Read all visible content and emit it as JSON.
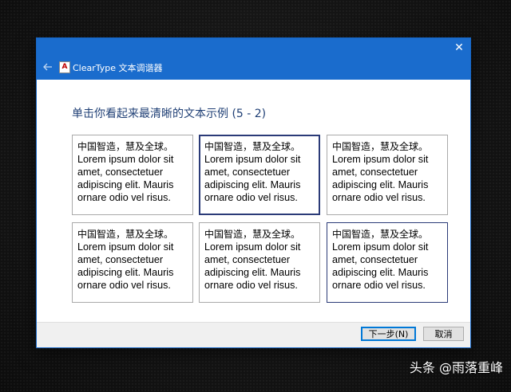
{
  "window": {
    "title": "ClearType 文本调谐器",
    "close_symbol": "✕",
    "app_icon_letter": "A"
  },
  "heading": "单击你看起来最清晰的文本示例 (5 - 2)",
  "samples": [
    {
      "cn": "中国智造，慧及全球。",
      "latin": "Lorem ipsum dolor sit amet, consectetuer adipiscing elit. Mauris ornare odio vel risus."
    },
    {
      "cn": "中国智造，慧及全球。",
      "latin": "Lorem ipsum dolor sit amet, consectetuer adipiscing elit. Mauris ornare odio vel risus."
    },
    {
      "cn": "中国智造，慧及全球。",
      "latin": "Lorem ipsum dolor sit amet, consectetuer adipiscing elit. Mauris ornare odio vel risus."
    },
    {
      "cn": "中国智造，慧及全球。",
      "latin": "Lorem ipsum dolor sit amet, consectetuer adipiscing elit. Mauris ornare odio vel risus."
    },
    {
      "cn": "中国智造，慧及全球。",
      "latin": "Lorem ipsum dolor sit amet, consectetuer adipiscing elit. Mauris ornare odio vel risus."
    },
    {
      "cn": "中国智造，慧及全球。",
      "latin": "Lorem ipsum dolor sit amet, consectetuer adipiscing elit. Mauris ornare odio vel risus."
    }
  ],
  "buttons": {
    "next": "下一步(N)",
    "cancel": "取消"
  },
  "watermark": "头条 @雨落重峰",
  "colors": {
    "titlebar": "#1a6ccd",
    "heading": "#1f3f75",
    "selected_border": "#2b3b78"
  }
}
